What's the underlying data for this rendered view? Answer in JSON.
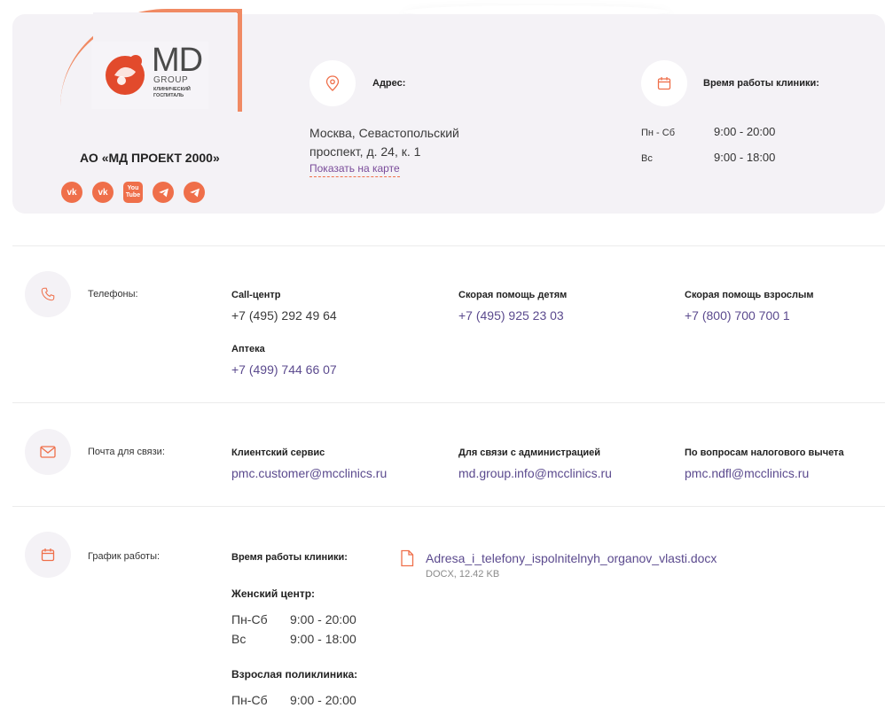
{
  "brand": {
    "logo_md": "MD",
    "logo_group": "GROUP",
    "logo_sub1": "КЛИНИЧЕСКИЙ",
    "logo_sub2": "ГОСПИТАЛЬ",
    "company": "АО «МД ПРОЕКТ 2000»",
    "accent": "#ef6f4a",
    "link_color": "#5b4a8e",
    "socials": [
      {
        "name": "vk-icon",
        "text": "vk"
      },
      {
        "name": "vk-icon",
        "text": "vk"
      },
      {
        "name": "youtube-icon",
        "text": "You Tube"
      },
      {
        "name": "telegram-icon",
        "text": ""
      },
      {
        "name": "telegram-icon",
        "text": ""
      }
    ]
  },
  "address": {
    "label": "Адрес:",
    "line1": "Москва, Севастопольский",
    "line2": "проспект, д. 24, к. 1",
    "map_link": "Показать на карте"
  },
  "clinic_hours": {
    "label": "Время работы клиники:",
    "rows": [
      {
        "day": "Пн - Сб",
        "time": "9:00 - 20:00"
      },
      {
        "day": "Вс",
        "time": "9:00 - 18:00"
      }
    ]
  },
  "phones": {
    "title": "Телефоны:",
    "callcenter_label": "Call-центр",
    "callcenter": "+7 (495) 292 49 64",
    "pharmacy_label": "Аптека",
    "pharmacy": "+7 (499) 744 66 07",
    "children_label": "Скорая помощь детям",
    "children": "+7 (495) 925 23 03",
    "adults_label": "Скорая помощь взрослым",
    "adults": "+7 (800) 700 700 1"
  },
  "mail": {
    "title": "Почта для связи:",
    "client_label": "Клиентский сервис",
    "client": "pmc.customer@mcclinics.ru",
    "admin_label": "Для связи с администрацией",
    "admin": "md.group.info@mcclinics.ru",
    "tax_label": "По вопросам налогового вычета",
    "tax": "pmc.ndfl@mcclinics.ru"
  },
  "schedule": {
    "title": "График работы:",
    "clinic_label": "Время работы клиники:",
    "women_label": "Женский центр:",
    "women_rows": [
      {
        "day": "Пн-Сб",
        "time": "9:00 - 20:00"
      },
      {
        "day": "Вс",
        "time": "9:00 - 18:00"
      }
    ],
    "adult_label": "Взрослая поликлиника:",
    "adult_rows": [
      {
        "day": "Пн-Сб",
        "time": "9:00 - 20:00"
      }
    ],
    "doc_name": "Adresa_i_telefony_ispolnitelnyh_organov_vlasti.docx",
    "doc_meta": "DOCX, 12.42 KB"
  }
}
